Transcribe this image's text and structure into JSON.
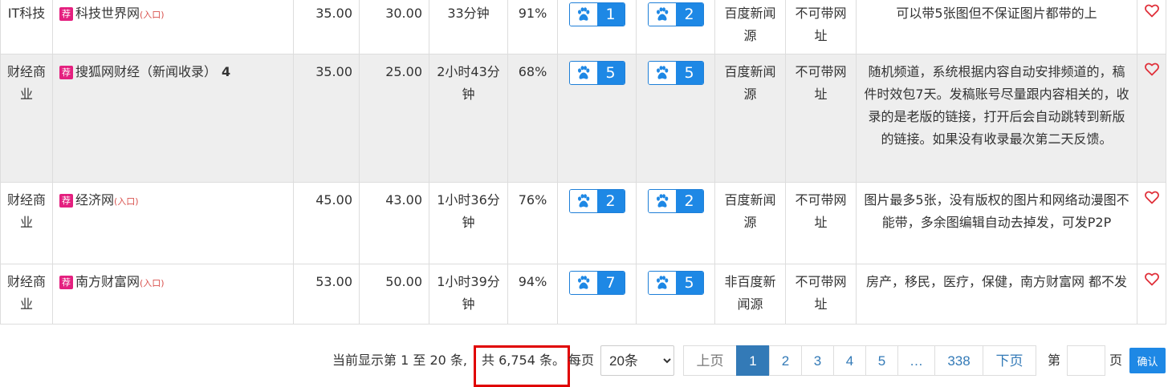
{
  "rows": [
    {
      "category": "IT科技",
      "tag": "荐",
      "name": "科技世界网",
      "entry": "(入口)",
      "suffix": "",
      "price1": "35.00",
      "price2": "30.00",
      "time": "33分钟",
      "rate": "91%",
      "badge1": "1",
      "badge2": "2",
      "source": "百度新闻源",
      "link": "不可带网址",
      "note": "可以带5张图但不保证图片都带的上"
    },
    {
      "category": "财经商业",
      "tag": "荐",
      "name": "搜狐网财经（新闻收录）",
      "entry": "",
      "suffix": "4",
      "price1": "35.00",
      "price2": "25.00",
      "time": "2小时43分钟",
      "rate": "68%",
      "badge1": "5",
      "badge2": "5",
      "source": "百度新闻源",
      "link": "不可带网址",
      "note": "随机频道，系统根据内容自动安排频道的，稿件时效包7天。发稿账号尽量跟内容相关的，收录的是老版的链接，打开后会自动跳转到新版的链接。如果没有收录最次第二天反馈。"
    },
    {
      "category": "财经商业",
      "tag": "荐",
      "name": "经济网",
      "entry": "(入口)",
      "suffix": "",
      "price1": "45.00",
      "price2": "43.00",
      "time": "1小时36分钟",
      "rate": "76%",
      "badge1": "2",
      "badge2": "2",
      "source": "百度新闻源",
      "link": "不可带网址",
      "note": "图片最多5张，没有版权的图片和网络动漫图不能带，多余图编辑自动去掉发，可发P2P"
    },
    {
      "category": "财经商业",
      "tag": "荐",
      "name": "南方财富网",
      "entry": "(入口)",
      "suffix": "",
      "price1": "53.00",
      "price2": "50.00",
      "time": "1小时39分钟",
      "rate": "94%",
      "badge1": "7",
      "badge2": "5",
      "source": "非百度新闻源",
      "link": "不可带网址",
      "note": "房产，移民，医疗，保健，南方财富网 都不发"
    }
  ],
  "footer": {
    "showing": "当前显示第 1 至 20 条,",
    "total": "共 6,754 条。",
    "per_page_label": "每页",
    "per_page_value": "20条",
    "prev": "上页",
    "pages": [
      "1",
      "2",
      "3",
      "4",
      "5",
      "…",
      "338"
    ],
    "active_page": "1",
    "next": "下页",
    "goto_label": "第",
    "page_unit": "页",
    "confirm": "确认"
  },
  "colors": {
    "accent": "#1e88e5",
    "tag": "#e4207f",
    "heart": "#e0303a",
    "highlight_box": "#e00000"
  },
  "icons": {
    "badge_icon": "paw-icon",
    "favorite_icon": "heart-icon"
  }
}
